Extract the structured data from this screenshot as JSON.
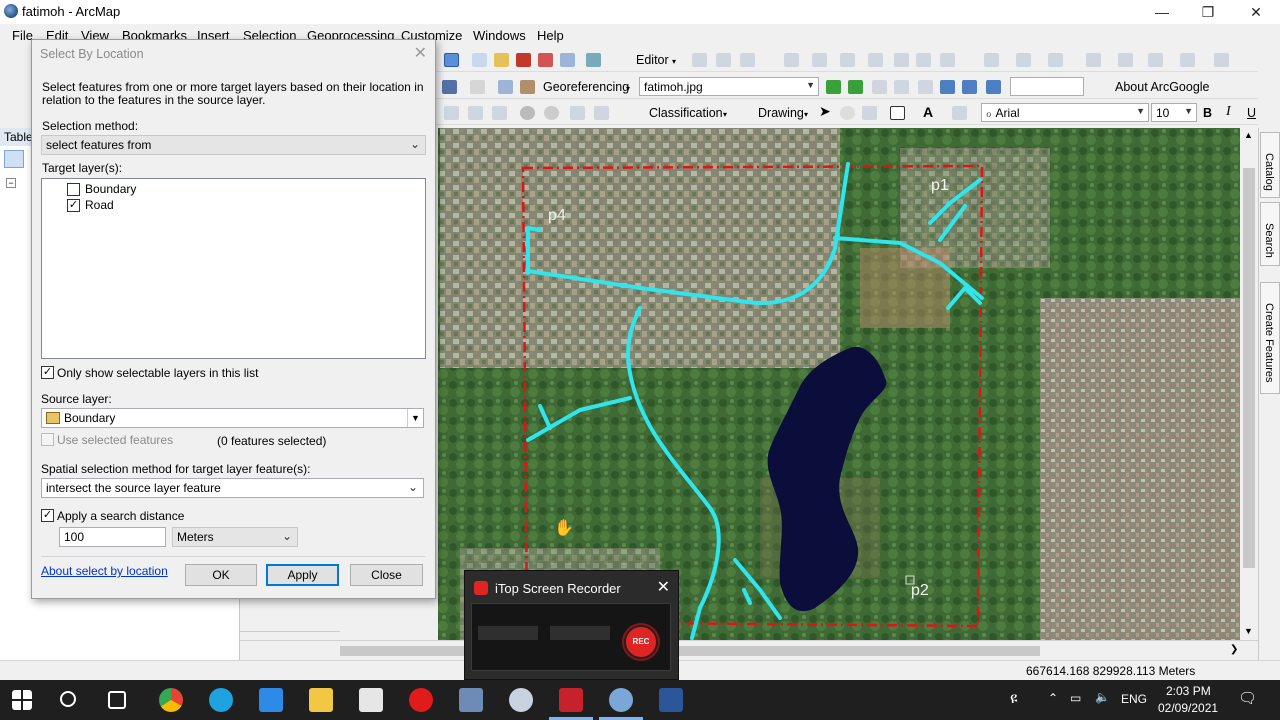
{
  "window": {
    "title": "fatimoh - ArcMap"
  },
  "menu": [
    "File",
    "Edit",
    "View",
    "Bookmarks",
    "Insert",
    "Selection",
    "Geoprocessing",
    "Customize",
    "Windows",
    "Help"
  ],
  "toolbar": {
    "editor": "Editor",
    "georeferencing": "Georeferencing",
    "georef_layer": "fatimoh.jpg",
    "about_arcgoogle": "About ArcGoogle",
    "classification": "Classification",
    "drawing": "Drawing",
    "font": "Arial",
    "font_size": "10",
    "bold": "B",
    "italic": "I",
    "underline": "U",
    "text_tool": "A"
  },
  "toc": {
    "header": "Table"
  },
  "right_dock": [
    "Catalog",
    "Search",
    "Create Features"
  ],
  "map": {
    "labels": {
      "p1": "p1",
      "p2": "p2",
      "p4": "p4"
    },
    "colors": {
      "road": "#2fe6ef",
      "boundary": "#e01414",
      "water": "#0b0d3a"
    }
  },
  "status": {
    "coordinates": "667614.168  829928.113 Meters"
  },
  "dialog": {
    "title": "Select By Location",
    "description": "Select features from one or more target layers based on their location in relation to the features in the source layer.",
    "selection_method_label": "Selection method:",
    "selection_method_value": "select features from",
    "target_layers_label": "Target layer(s):",
    "target_layers": [
      {
        "name": "Boundary",
        "checked": false
      },
      {
        "name": "Road",
        "checked": true
      }
    ],
    "only_selectable_label": "Only show selectable layers in this list",
    "source_layer_label": "Source layer:",
    "source_layer_value": "Boundary",
    "use_selected_label": "Use selected features",
    "features_selected": "(0 features selected)",
    "spatial_method_label": "Spatial selection method for target layer feature(s):",
    "spatial_method_value": "intersect the source layer feature",
    "search_distance_label": "Apply a search distance",
    "search_distance_value": "100",
    "search_distance_unit": "Meters",
    "about_link": "About select by location",
    "ok": "OK",
    "apply": "Apply",
    "close": "Close"
  },
  "recorder": {
    "title": "iTop Screen Recorder",
    "rec": "REC"
  },
  "taskbar": {
    "lang": "ENG",
    "time": "2:03 PM",
    "date": "02/09/2021"
  }
}
